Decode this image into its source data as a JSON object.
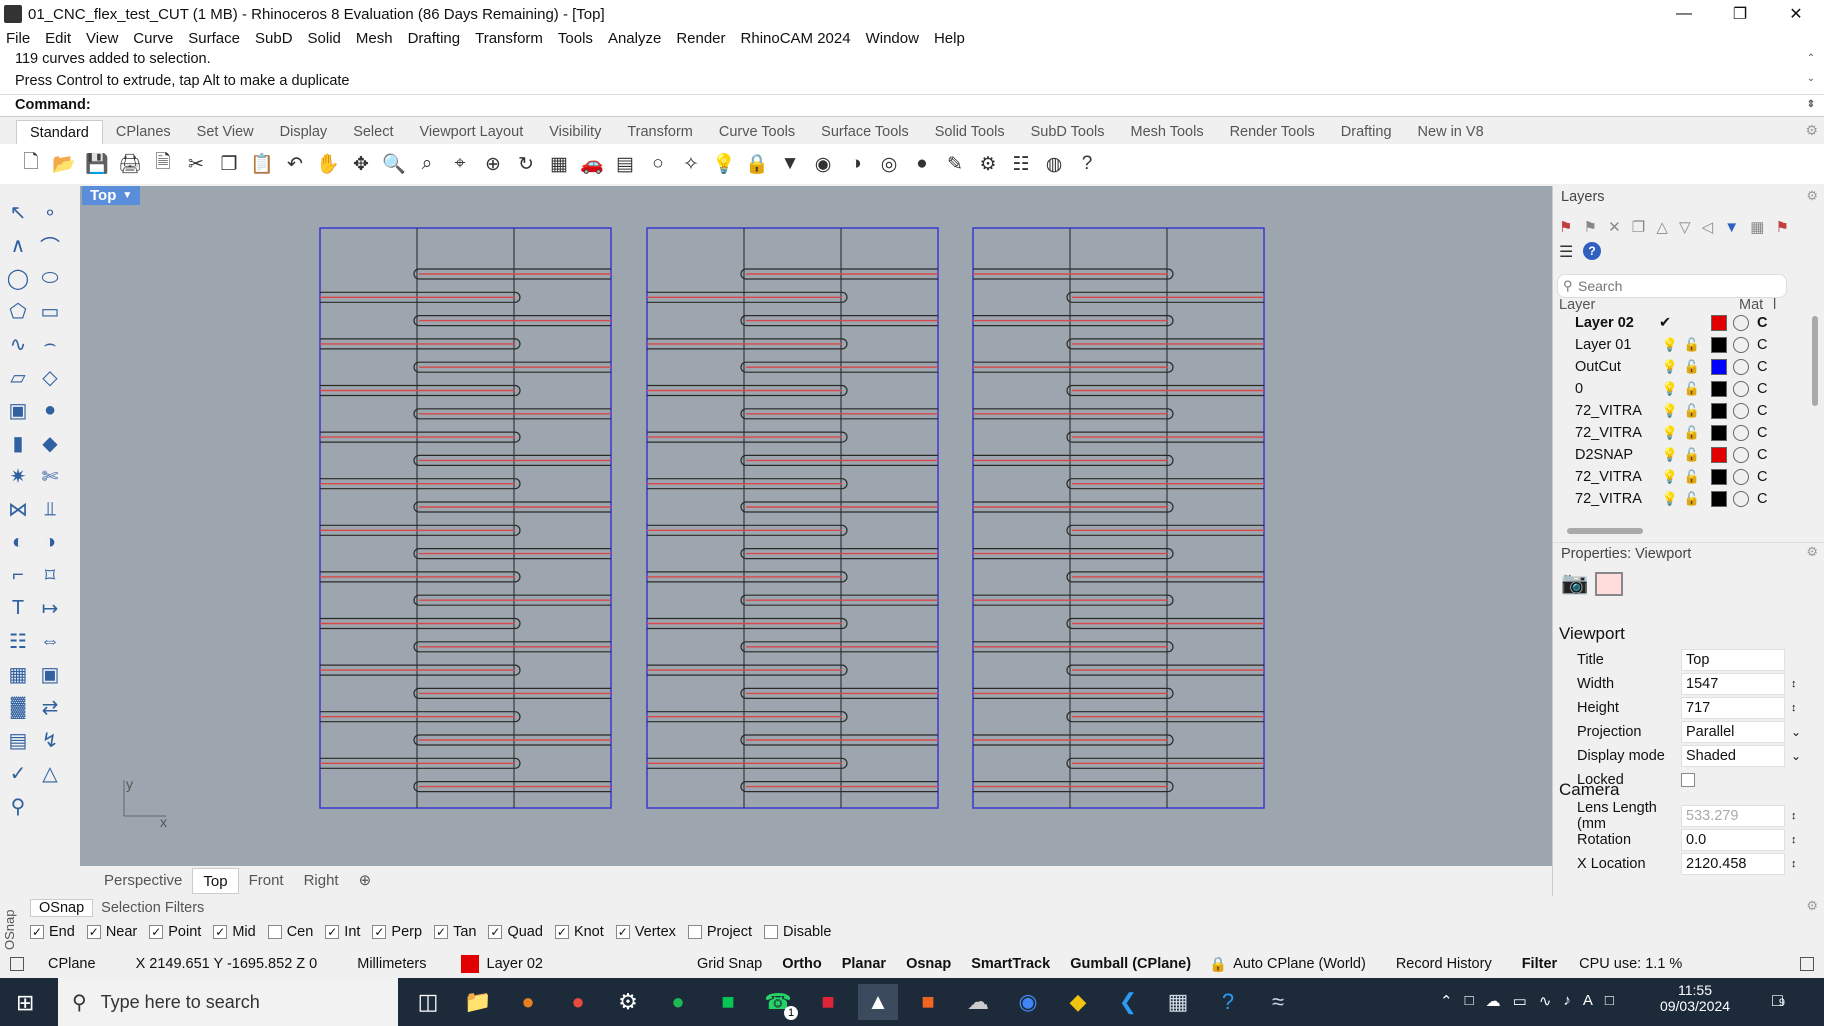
{
  "window": {
    "title": "01_CNC_flex_test_CUT (1 MB) - Rhinoceros 8 Evaluation (86 Days Remaining) - [Top]",
    "controls": {
      "minimize": "—",
      "restore": "❐",
      "close": "✕"
    }
  },
  "menu": [
    "File",
    "Edit",
    "View",
    "Curve",
    "Surface",
    "SubD",
    "Solid",
    "Mesh",
    "Drafting",
    "Transform",
    "Tools",
    "Analyze",
    "Render",
    "RhinoCAM 2024",
    "Window",
    "Help"
  ],
  "command": {
    "history": [
      "119 curves added to selection.",
      "Press Control to extrude, tap Alt to make a duplicate"
    ],
    "prompt": "Command:"
  },
  "toolbar_tabs": [
    "Standard",
    "CPlanes",
    "Set View",
    "Display",
    "Select",
    "Viewport Layout",
    "Visibility",
    "Transform",
    "Curve Tools",
    "Surface Tools",
    "Solid Tools",
    "SubD Tools",
    "Mesh Tools",
    "Render Tools",
    "Drafting",
    "New in V8"
  ],
  "toolbar_icons": [
    "new-icon",
    "open-icon",
    "save-icon",
    "print-icon",
    "import-icon",
    "cut-icon",
    "copy-icon",
    "paste-icon",
    "undo-icon",
    "pan-icon",
    "rotate-view-icon",
    "zoom-icon",
    "zoom-window-icon",
    "zoom-extents-icon",
    "zoom-selected-icon",
    "rotate-icon",
    "grid-icon",
    "car-icon",
    "layout-icon",
    "point-icon",
    "snap-icon",
    "light-icon",
    "lock-icon",
    "shield-icon",
    "color-wheel-icon",
    "shade-icon",
    "render-icon",
    "sphere-icon",
    "brush-icon",
    "gear-icon",
    "tree-icon",
    "globe-icon",
    "help-icon"
  ],
  "viewport": {
    "label": "Top",
    "axis_y": "y",
    "axis_x": "x",
    "tabs": [
      "Perspective",
      "Top",
      "Front",
      "Right"
    ],
    "active_tab": "Top",
    "add_tab": "⊕"
  },
  "layers_panel": {
    "title": "Layers",
    "search_placeholder": "Search",
    "col_layer": "Layer",
    "col_mat": "Mat",
    "col_extra": "l",
    "layers": [
      {
        "name": "Layer 02",
        "color": "#e00000",
        "current": true,
        "c": "C"
      },
      {
        "name": "Layer 01",
        "color": "#000000",
        "current": false,
        "c": "C"
      },
      {
        "name": "OutCut",
        "color": "#0000ff",
        "current": false,
        "c": "C"
      },
      {
        "name": "0",
        "color": "#000000",
        "current": false,
        "c": "C"
      },
      {
        "name": "72_VITRA",
        "color": "#000000",
        "current": false,
        "c": "C"
      },
      {
        "name": "72_VITRA",
        "color": "#000000",
        "current": false,
        "c": "C"
      },
      {
        "name": "D2SNAP",
        "color": "#e00000",
        "current": false,
        "c": "C"
      },
      {
        "name": "72_VITRA",
        "color": "#000000",
        "current": false,
        "c": "C"
      },
      {
        "name": "72_VITRA",
        "color": "#000000",
        "current": false,
        "c": "C"
      }
    ]
  },
  "properties_panel": {
    "title": "Properties: Viewport",
    "section_viewport": "Viewport",
    "section_camera": "Camera",
    "rows": [
      {
        "label": "Title",
        "value": "Top"
      },
      {
        "label": "Width",
        "value": "1547"
      },
      {
        "label": "Height",
        "value": "717"
      },
      {
        "label": "Projection",
        "value": "Parallel"
      },
      {
        "label": "Display mode",
        "value": "Shaded"
      },
      {
        "label": "Locked",
        "value": ""
      }
    ],
    "camera_rows": [
      {
        "label": "Lens Length (mm",
        "value": "533.279"
      },
      {
        "label": "Rotation",
        "value": "0.0"
      },
      {
        "label": "X Location",
        "value": "2120.458"
      }
    ]
  },
  "osnap": {
    "side_label": "OSnap",
    "tabs": [
      "OSnap",
      "Selection Filters"
    ],
    "items": [
      {
        "label": "End",
        "checked": true
      },
      {
        "label": "Near",
        "checked": true
      },
      {
        "label": "Point",
        "checked": true
      },
      {
        "label": "Mid",
        "checked": true
      },
      {
        "label": "Cen",
        "checked": false
      },
      {
        "label": "Int",
        "checked": true
      },
      {
        "label": "Perp",
        "checked": true
      },
      {
        "label": "Tan",
        "checked": true
      },
      {
        "label": "Quad",
        "checked": true
      },
      {
        "label": "Knot",
        "checked": true
      },
      {
        "label": "Vertex",
        "checked": true
      },
      {
        "label": "Project",
        "checked": false
      },
      {
        "label": "Disable",
        "checked": false
      }
    ]
  },
  "status": {
    "cplane": "CPlane",
    "coords": "X 2149.651 Y -1695.852 Z 0",
    "units": "Millimeters",
    "layer_color": "#e00000",
    "layer": "Layer 02",
    "grid_snap": "Grid Snap",
    "ortho": "Ortho",
    "planar": "Planar",
    "osnap": "Osnap",
    "smarttrack": "SmartTrack",
    "gumball": "Gumball (CPlane)",
    "auto_cplane": "Auto CPlane (World)",
    "record_history": "Record History",
    "filter": "Filter",
    "cpu": "CPU use: 1.1 %"
  },
  "taskbar": {
    "search_placeholder": "Type here to search",
    "time": "11:55",
    "date": "09/03/2024",
    "notif_count": "9",
    "whatsapp_badge": "1"
  },
  "colors": {
    "viewport_bg": "#9da6ae",
    "panel_outline": "#3a3ad0",
    "cut_line": "#d84848",
    "slot_outline": "#2a2a2a",
    "active_label": "#5a8edb"
  }
}
